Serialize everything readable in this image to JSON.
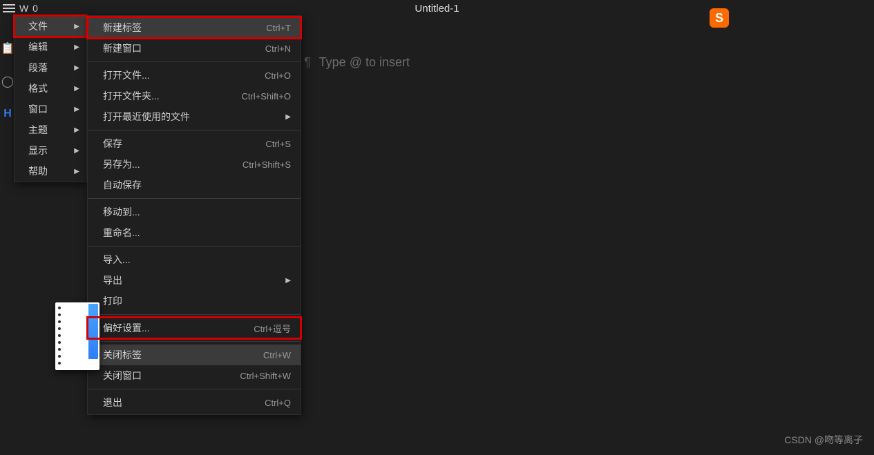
{
  "titlebar": {
    "left_text": "W 0",
    "center_text": "Untitled-1"
  },
  "badge_letter": "S",
  "editor": {
    "pilcrow": "¶",
    "placeholder": "Type @ to insert"
  },
  "main_menu": {
    "items": [
      {
        "label": "文件",
        "arrow": true,
        "highlighted": true
      },
      {
        "label": "编辑",
        "arrow": true,
        "highlighted": false
      },
      {
        "label": "段落",
        "arrow": true,
        "highlighted": false
      },
      {
        "label": "格式",
        "arrow": true,
        "highlighted": false
      },
      {
        "label": "窗口",
        "arrow": true,
        "highlighted": false
      },
      {
        "label": "主题",
        "arrow": true,
        "highlighted": false
      },
      {
        "label": "显示",
        "arrow": true,
        "highlighted": false
      },
      {
        "label": "帮助",
        "arrow": true,
        "highlighted": false
      }
    ]
  },
  "sub_menu": {
    "items": [
      {
        "label": "新建标签",
        "shortcut": "Ctrl+T",
        "highlighted": true,
        "red_box": true
      },
      {
        "label": "新建窗口",
        "shortcut": "Ctrl+N"
      },
      {
        "sep": true
      },
      {
        "label": "打开文件...",
        "shortcut": "Ctrl+O"
      },
      {
        "label": "打开文件夹...",
        "shortcut": "Ctrl+Shift+O"
      },
      {
        "label": "打开最近使用的文件",
        "arrow": true
      },
      {
        "sep": true
      },
      {
        "label": "保存",
        "shortcut": "Ctrl+S"
      },
      {
        "label": "另存为...",
        "shortcut": "Ctrl+Shift+S"
      },
      {
        "label": "自动保存"
      },
      {
        "sep": true
      },
      {
        "label": "移动到..."
      },
      {
        "label": "重命名..."
      },
      {
        "sep": true
      },
      {
        "label": "导入..."
      },
      {
        "label": "导出",
        "arrow": true
      },
      {
        "label": "打印"
      },
      {
        "sep": true
      },
      {
        "label": "偏好设置...",
        "shortcut": "Ctrl+逗号",
        "red_box": true
      },
      {
        "sep": true
      },
      {
        "label": "关闭标签",
        "shortcut": "Ctrl+W",
        "highlighted": true
      },
      {
        "label": "关闭窗口",
        "shortcut": "Ctrl+Shift+W"
      },
      {
        "sep": true
      },
      {
        "label": "退出",
        "shortcut": "Ctrl+Q"
      }
    ]
  },
  "left_icons": {
    "clipboard": "📋",
    "circle": "◯",
    "h": "H"
  },
  "watermark": "CSDN @吻等离子"
}
